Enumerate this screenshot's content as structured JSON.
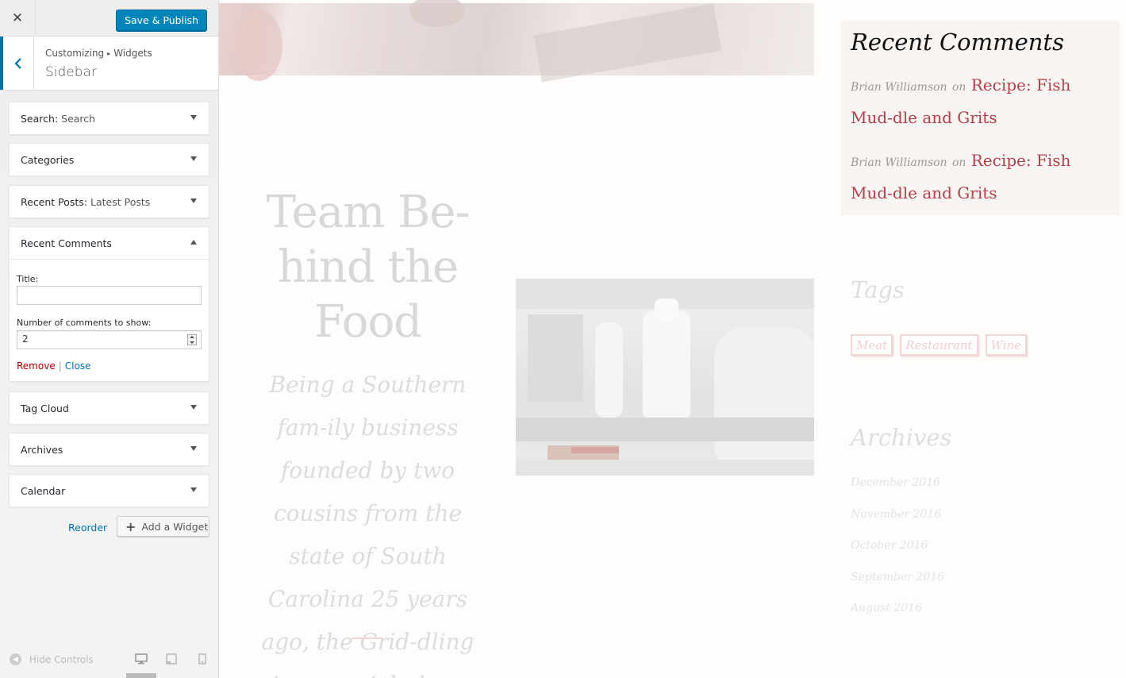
{
  "customizer": {
    "close_glyph": "✕",
    "save_publish": "Save & Publish",
    "breadcrumb": [
      "Customizing",
      "Widgets"
    ],
    "breadcrumb_sep": "▸",
    "section_title": "Sidebar",
    "widgets": [
      {
        "title": "Search:",
        "sub": " Search",
        "expanded": false
      },
      {
        "title": "Categories",
        "sub": "",
        "expanded": false
      },
      {
        "title": "Recent Posts:",
        "sub": " Latest Posts",
        "expanded": false
      },
      {
        "title": "Recent Comments",
        "sub": "",
        "expanded": true
      },
      {
        "title": "Tag Cloud",
        "sub": "",
        "expanded": false
      },
      {
        "title": "Archives",
        "sub": "",
        "expanded": false
      },
      {
        "title": "Calendar",
        "sub": "",
        "expanded": false
      }
    ],
    "recent_comments_form": {
      "title_label": "Title:",
      "title_value": "",
      "number_label": "Number of comments to show:",
      "number_value": "2",
      "remove": "Remove",
      "separator": "|",
      "close": "Close"
    },
    "reorder": "Reorder",
    "add_widget": "Add a Widget",
    "add_widget_glyph": "+",
    "hide_controls": "Hide Controls"
  },
  "preview": {
    "team_heading": "Team Be-hind the Food",
    "team_body": "Being a Southern fam-ily business founded by two cousins from the state of South Carolina 25 years ago, the Grid-dling is a special place",
    "recent_comments": {
      "title": "Recent Comments",
      "items": [
        {
          "author": "Brian Williamson",
          "on": "on",
          "post": "Recipe: Fish Mud-dle and Grits"
        },
        {
          "author": "Brian Williamson",
          "on": "on",
          "post": "Recipe: Fish Mud-dle and Grits"
        }
      ]
    },
    "tags": {
      "title": "Tags",
      "items": [
        "Meat",
        "Restaurant",
        "Wine"
      ]
    },
    "archives": {
      "title": "Archives",
      "items": [
        "December 2016",
        "November 2016",
        "October 2016",
        "September 2016",
        "August 2016"
      ]
    }
  },
  "colors": {
    "primary_button": "#0085ba",
    "link": "#0073aa",
    "remove": "#aa0000",
    "accent_link": "#b23f4c"
  }
}
